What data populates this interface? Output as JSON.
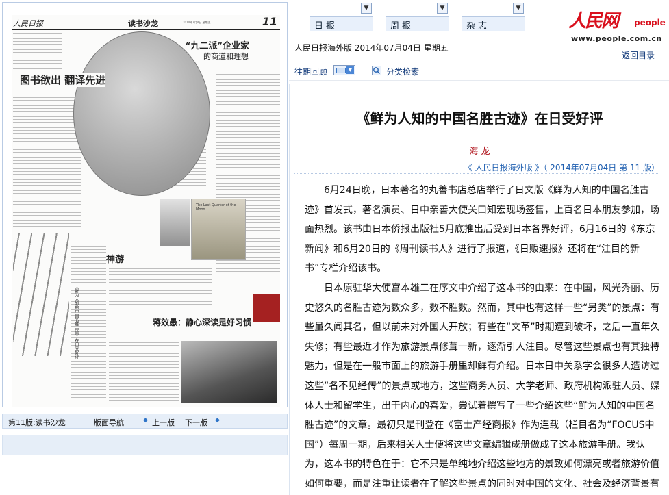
{
  "newspaper": {
    "masthead": "人民日报",
    "section": "读书沙龙",
    "page_number": "11",
    "meta": "2014年7月4日 星期五",
    "headline_main": "图书欲出 翻译先进",
    "headline_round": "“九二派”企业家",
    "headline_round_sub": "的商道和理想",
    "headline_small_1": "神游",
    "headline_small_2": "《鲜为人知的中国名胜古迹》在日受好评",
    "headline_bottom": "蒋效愚：静心深读是好习惯",
    "book_cover_title": "The Last Quarter of the Moon"
  },
  "page_nav": {
    "current_page": "第11版:读书沙龙",
    "page_guide": "版面导航",
    "prev": "上一版",
    "next": "下一版"
  },
  "selectors": [
    {
      "label": "日报"
    },
    {
      "label": "周报"
    },
    {
      "label": "杂志"
    }
  ],
  "brand": {
    "logo_cn": "人民网",
    "logo_en": "people",
    "url": "www.people.com.cn",
    "color": "#d9101d"
  },
  "edition_line": "人民日报海外版 2014年07月04日 星期五",
  "back_link": "返回目录",
  "toolbar": {
    "past_review": "往期回顾",
    "category_search": "分类检索"
  },
  "article": {
    "title": "《鲜为人知的中国名胜古迹》在日受好评",
    "author": "海 龙",
    "source": "《 人民日报海外版 》（ 2014年07月04日   第 11 版）",
    "paragraphs": [
      "6月24日晚，日本著名的丸善书店总店举行了日文版《鲜为人知的中国名胜古迹》首发式，著名演员、日中亲善大使关口知宏现场签售，上百名日本朋友参加，场面热烈。该书由日本侨报出版社5月底推出后受到日本各界好评，6月16日的《东京新闻》和6月20日的《周刊读书人》进行了报道，《日贩速报》还将在“注目的新书”专栏介绍该书。",
      "日本原驻华大使宫本雄二在序文中介绍了这本书的由来：在中国，风光秀丽、历史悠久的名胜古迹为数众多，数不胜数。然而，其中也有这样一些“另类”的景点：有些虽久闻其名，但以前未对外国人开放；有些在“文革”时期遭到破坏，之后一直年久失修；有些最近才作为旅游景点修葺一新，逐渐引人注目。尽管这些景点也有其独特魅力，但是在一般市面上的旅游手册里却鲜有介绍。日本日中关系学会很多人造访过这些“名不见经传”的景点或地方，这些商务人员、大学老师、政府机构派驻人员、媒体人士和留学生，出于内心的喜爱，尝试着撰写了一些介绍这些“鲜为人知的中国名胜古迹”的文章。最初只是刊登在《富士产经商报》作为连载（栏目名为“FOCUS中国”）每周一期，后来相关人士便将这些文章编辑成册做成了这本旅游手册。我认为，这本书的特色在于：它不只是单纯地介绍这些地方的景致如何漂亮或者旅游价值如何重要，而是注重让读者在了解这些景点的同时对中国的文化、社会及经济背景有所认知。"
    ]
  }
}
